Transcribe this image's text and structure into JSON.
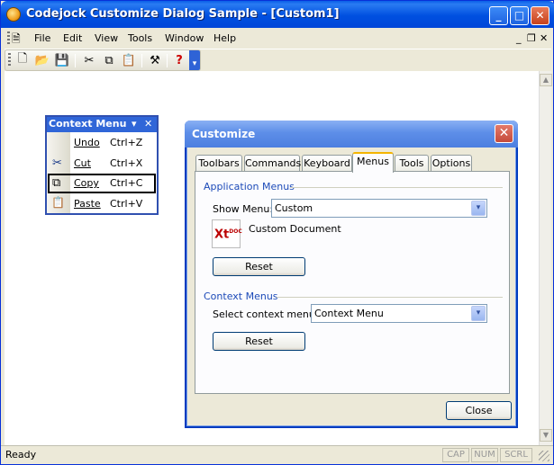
{
  "window": {
    "title": "Codejock Customize Dialog Sample - [Custom1]",
    "minimize": "_",
    "maximize": "□",
    "close": "✕"
  },
  "menubar": {
    "items": [
      "File",
      "Edit",
      "View",
      "Tools",
      "Window",
      "Help"
    ],
    "mdi_min": "_",
    "mdi_restore": "❐",
    "mdi_close": "✕"
  },
  "toolbar": {
    "icons": [
      "new-icon",
      "open-icon",
      "save-icon",
      "cut-icon",
      "copy-icon",
      "paste-icon",
      "tools-icon",
      "help-icon"
    ],
    "glyphs": {
      "new": "🗋",
      "open": "📂",
      "save": "💾",
      "cut": "✂",
      "copy": "⧉",
      "paste": "📋",
      "tools": "⚒",
      "help": "?",
      "more": "▾"
    }
  },
  "context_menu": {
    "title": "Context Menu",
    "items": [
      {
        "label": "Undo",
        "shortcut": "Ctrl+Z",
        "icon": ""
      },
      {
        "label": "Cut",
        "shortcut": "Ctrl+X",
        "icon": "✂"
      },
      {
        "label": "Copy",
        "shortcut": "Ctrl+C",
        "icon": "⧉"
      },
      {
        "label": "Paste",
        "shortcut": "Ctrl+V",
        "icon": "📋"
      }
    ],
    "dropdown": "▾",
    "close": "✕"
  },
  "dialog": {
    "title": "Customize",
    "close": "✕",
    "tabs": [
      "Toolbars",
      "Commands",
      "Keyboard",
      "Menus",
      "Tools",
      "Options"
    ],
    "active_tab": "Menus",
    "app_menus": {
      "heading": "Application Menus",
      "show_label": "Show Menu:",
      "show_value": "Custom",
      "doc_label": "Custom Document",
      "icon_text": "Xt",
      "icon_badge": "DOC",
      "reset": "Reset"
    },
    "ctx_menus": {
      "heading": "Context Menus",
      "select_label": "Select context menu:",
      "select_value": "Context Menu",
      "reset": "Reset"
    },
    "close_button": "Close",
    "dropdown_glyph": "▾"
  },
  "statusbar": {
    "text": "Ready",
    "panes": [
      "CAP",
      "NUM",
      "SCRL"
    ]
  },
  "scrollbar": {
    "up": "▲",
    "down": "▼"
  }
}
